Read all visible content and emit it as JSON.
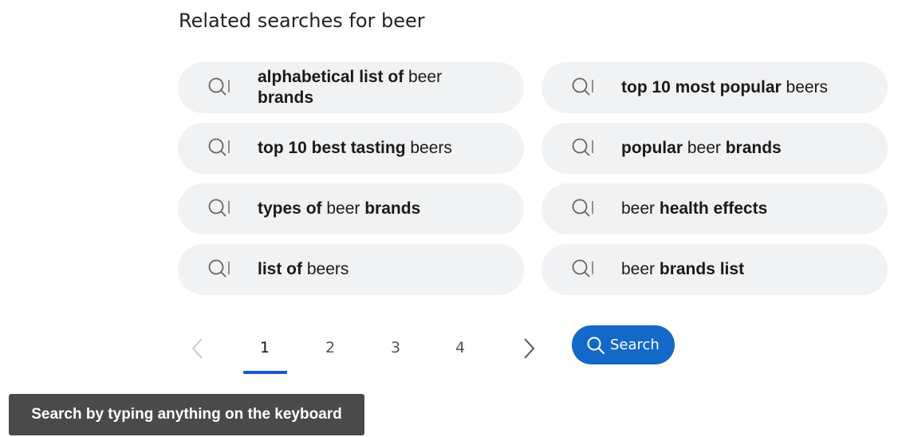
{
  "related": {
    "title": "Related searches for beer",
    "items": [
      {
        "parts": [
          {
            "text": "alphabetical list of ",
            "bold": true
          },
          {
            "text": "beer ",
            "bold": false
          },
          {
            "text": "brands",
            "bold": true
          }
        ]
      },
      {
        "parts": [
          {
            "text": "top 10 most popular ",
            "bold": true
          },
          {
            "text": "beers",
            "bold": false
          }
        ]
      },
      {
        "parts": [
          {
            "text": "top 10 best tasting ",
            "bold": true
          },
          {
            "text": "beers",
            "bold": false
          }
        ]
      },
      {
        "parts": [
          {
            "text": "popular ",
            "bold": true
          },
          {
            "text": "beer ",
            "bold": false
          },
          {
            "text": "brands",
            "bold": true
          }
        ]
      },
      {
        "parts": [
          {
            "text": "types of ",
            "bold": true
          },
          {
            "text": "beer ",
            "bold": false
          },
          {
            "text": "brands",
            "bold": true
          }
        ]
      },
      {
        "parts": [
          {
            "text": "beer ",
            "bold": false
          },
          {
            "text": "health effects",
            "bold": true
          }
        ]
      },
      {
        "parts": [
          {
            "text": "list of ",
            "bold": true
          },
          {
            "text": "beers",
            "bold": false
          }
        ]
      },
      {
        "parts": [
          {
            "text": "beer ",
            "bold": false
          },
          {
            "text": "brands list",
            "bold": true
          }
        ]
      }
    ],
    "icon": "search-icon"
  },
  "pagination": {
    "prev_icon": "chevron-left-icon",
    "next_icon": "chevron-right-icon",
    "pages": [
      "1",
      "2",
      "3",
      "4"
    ],
    "current_page": "1"
  },
  "search_button": {
    "label": "Search",
    "icon": "search-icon"
  },
  "tooltip": {
    "text": "Search by typing anything on the keyboard"
  },
  "colors": {
    "chip_bg": "#f1f2f4",
    "button_bg": "#1468c8",
    "active_underline": "#1a56db",
    "tooltip_bg": "#4a4a4a"
  }
}
